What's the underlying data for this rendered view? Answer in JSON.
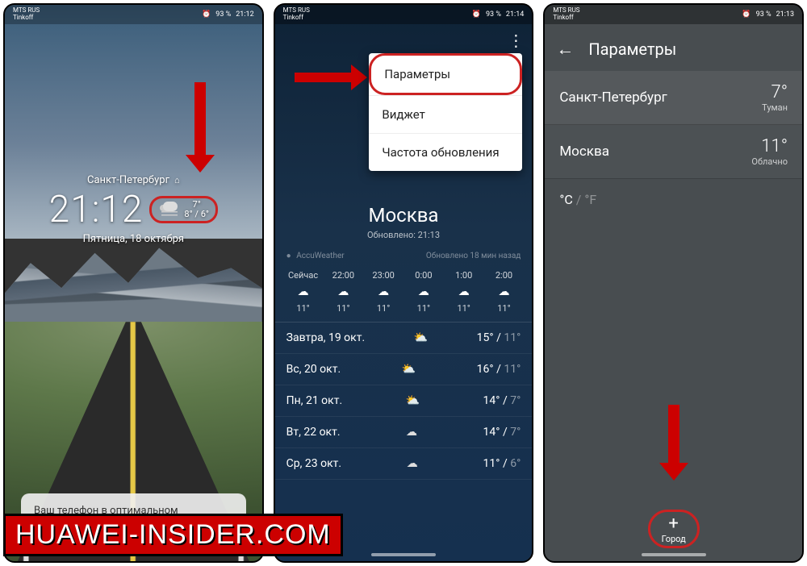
{
  "statusbar": {
    "carrier": "MTS RUS",
    "operator": "Tinkoff",
    "battery": "93 %",
    "alarm_icon": "⏰",
    "signal_icon": "📶"
  },
  "screen1": {
    "time_status": "21:12",
    "city": "Санкт-Петербург",
    "clock": "21:12",
    "temp_now": "7°",
    "temp_range": "8° / 6°",
    "date": "Пятница, 18 октября",
    "note": "Ваш телефон в оптимальном состоянии."
  },
  "screen2": {
    "time_status": "21:14",
    "menu": {
      "item1": "Параметры",
      "item2": "Виджет",
      "item3": "Частота обновления"
    },
    "dim_label": "Облачно",
    "city": "Москва",
    "updated": "Обновлено: 21:13",
    "source": "AccuWeather",
    "source_bullet": "●",
    "ago": "Обновлено 18 мин назад",
    "hours": [
      {
        "h": "Сейчас",
        "t": "11°"
      },
      {
        "h": "22:00",
        "t": "11°"
      },
      {
        "h": "23:00",
        "t": "11°"
      },
      {
        "h": "0:00",
        "t": "11°"
      },
      {
        "h": "1:00",
        "t": "11°"
      },
      {
        "h": "2:00",
        "t": "11°"
      }
    ],
    "days": [
      {
        "d": "Завтра, 19 окт.",
        "hi": "15°",
        "lo": "11°"
      },
      {
        "d": "Вс, 20 окт.",
        "hi": "16°",
        "lo": "11°"
      },
      {
        "d": "Пн, 21 окт.",
        "hi": "14°",
        "lo": "7°"
      },
      {
        "d": "Вт, 22 окт.",
        "hi": "14°",
        "lo": "7°"
      },
      {
        "d": "Ср, 23 окт.",
        "hi": "11°",
        "lo": "6°"
      }
    ]
  },
  "screen3": {
    "time_status": "21:13",
    "title": "Параметры",
    "cities": [
      {
        "name": "Санкт-Петербург",
        "temp": "7°",
        "cond": "Туман"
      },
      {
        "name": "Москва",
        "temp": "11°",
        "cond": "Облачно"
      }
    ],
    "unit_c": "°C",
    "unit_f": "°F",
    "add_symbol": "+",
    "add_label": "Город"
  },
  "watermark": "HUAWEI-INSIDER.COM"
}
